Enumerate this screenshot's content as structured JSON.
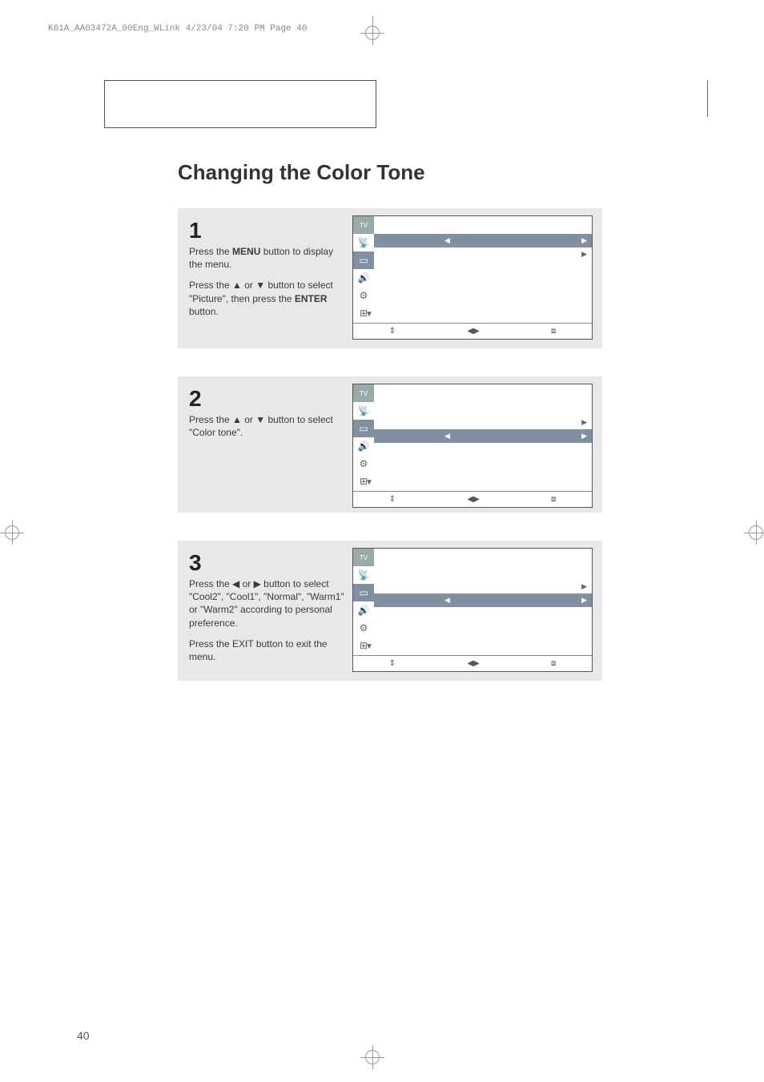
{
  "header_line": "K61A_AA03472A_00Eng_WLink  4/23/04  7:20 PM  Page 40",
  "title": "Changing the Color Tone",
  "page_number": "40",
  "steps": {
    "s1": {
      "num": "1",
      "p1_a": "Press the ",
      "p1_b": "MENU",
      "p1_c": " button to display the menu.",
      "p2_a": "Press the ▲ or ▼ button to select \"Picture\", then press the ",
      "p2_b": "ENTER",
      "p2_c": " button."
    },
    "s2": {
      "num": "2",
      "p1": "Press the ▲ or ▼ button to select \"Color tone\"."
    },
    "s3": {
      "num": "3",
      "p1": "Press the ◀ or ▶ button to select \"Cool2\", \"Cool1\",  \"Normal\", \"Warm1\" or \"Warm2\" according to personal preference.",
      "p2": "Press the EXIT button to exit the menu."
    }
  },
  "menu": {
    "tv": "TV",
    "more": "▼",
    "footer": {
      "ud": "⇕",
      "lr": "◀▶",
      "exit": "⧈"
    },
    "highlight_left": "◀",
    "highlight_right": "▶",
    "right_arrow": "▶"
  }
}
